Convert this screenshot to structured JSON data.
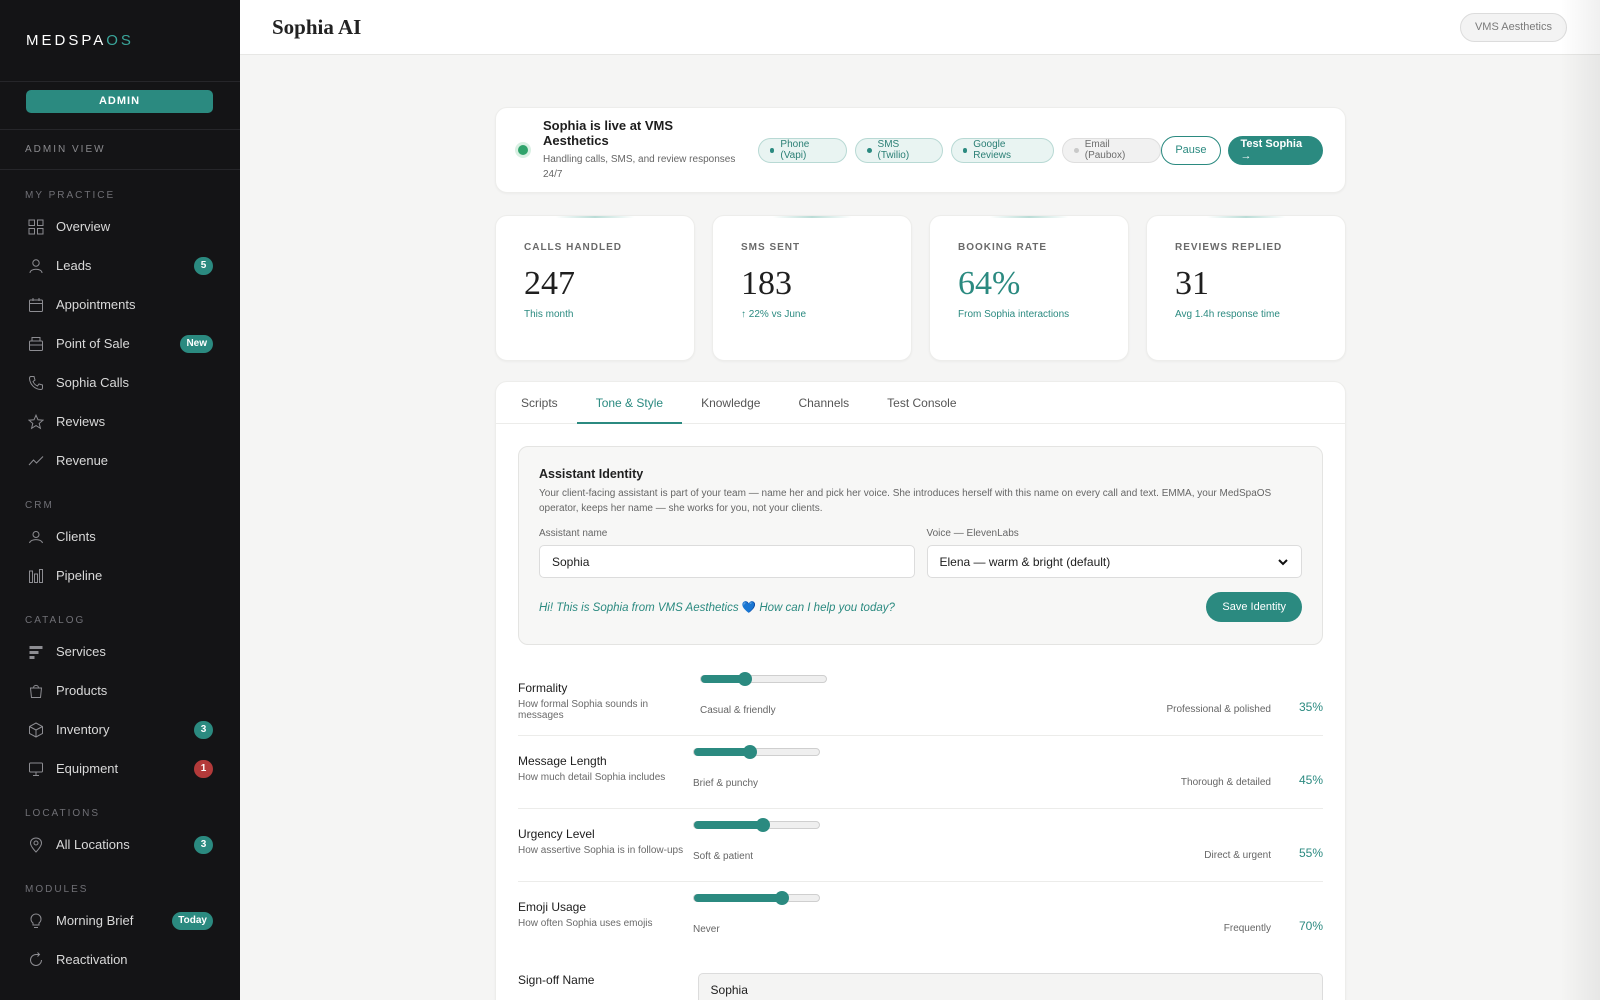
{
  "sidebar": {
    "logo_main": "MEDSPA",
    "logo_accent": "OS",
    "role_button": "ADMIN",
    "view_label": "ADMIN VIEW",
    "sections": [
      {
        "label": "MY PRACTICE",
        "items": [
          {
            "label": "Overview",
            "icon": "grid-icon"
          },
          {
            "label": "Leads",
            "icon": "user-icon",
            "badge": "5"
          },
          {
            "label": "Appointments",
            "icon": "calendar-icon"
          },
          {
            "label": "Point of Sale",
            "icon": "register-icon",
            "badge": "New"
          },
          {
            "label": "Sophia Calls",
            "icon": "phone-icon"
          },
          {
            "label": "Reviews",
            "icon": "star-icon"
          },
          {
            "label": "Revenue",
            "icon": "trend-icon"
          }
        ]
      },
      {
        "label": "CRM",
        "items": [
          {
            "label": "Clients",
            "icon": "clients-icon"
          },
          {
            "label": "Pipeline",
            "icon": "pipeline-icon"
          }
        ]
      },
      {
        "label": "CATALOG",
        "items": [
          {
            "label": "Services",
            "icon": "services-icon"
          },
          {
            "label": "Products",
            "icon": "bag-icon"
          },
          {
            "label": "Inventory",
            "icon": "box-icon",
            "badge": "3"
          },
          {
            "label": "Equipment",
            "icon": "monitor-icon",
            "badge": "1",
            "badge_color": "#b33a3a"
          }
        ]
      },
      {
        "label": "LOCATIONS",
        "items": [
          {
            "label": "All Locations",
            "icon": "pin-icon",
            "badge": "3"
          }
        ]
      },
      {
        "label": "MODULES",
        "items": [
          {
            "label": "Morning Brief",
            "icon": "bulb-icon",
            "badge": "Today"
          },
          {
            "label": "Reactivation",
            "icon": "refresh-icon"
          }
        ]
      }
    ]
  },
  "header": {
    "title": "Sophia AI",
    "practice": "VMS Aesthetics"
  },
  "status": {
    "title": "Sophia is live at VMS Aesthetics",
    "subtitle": "Handling calls, SMS, and review responses 24/7",
    "channels": [
      {
        "label": "Phone (Vapi)",
        "active": true
      },
      {
        "label": "SMS (Twilio)",
        "active": true
      },
      {
        "label": "Google Reviews",
        "active": true
      },
      {
        "label": "Email (Paubox)",
        "active": false
      }
    ],
    "pause_label": "Pause",
    "test_label": "Test Sophia →"
  },
  "stats": [
    {
      "label": "CALLS HANDLED",
      "value": "247",
      "note": "This month"
    },
    {
      "label": "SMS SENT",
      "value": "183",
      "note": "↑ 22% vs June"
    },
    {
      "label": "BOOKING RATE",
      "value": "64%",
      "note": "From Sophia interactions",
      "teal": true
    },
    {
      "label": "REVIEWS REPLIED",
      "value": "31",
      "note": "Avg 1.4h response time"
    }
  ],
  "tabs": [
    {
      "label": "Scripts",
      "active": false
    },
    {
      "label": "Tone & Style",
      "active": true
    },
    {
      "label": "Knowledge",
      "active": false
    },
    {
      "label": "Channels",
      "active": false
    },
    {
      "label": "Test Console",
      "active": false
    }
  ],
  "identity": {
    "title": "Assistant Identity",
    "description": "Your client-facing assistant is part of your team — name her and pick her voice. She introduces herself with this name on every call and text. EMMA, your MedSpaOS operator, keeps her name — she works for you, not your clients.",
    "name_label": "Assistant name",
    "name_value": "Sophia",
    "voice_label": "Voice — ElevenLabs",
    "voice_value": "Elena — warm & bright (default)",
    "greeting": "Hi! This is Sophia from VMS Aesthetics",
    "greeting_end": "How can I help you today?",
    "save_label": "Save Identity"
  },
  "sliders": [
    {
      "name": "Formality",
      "desc": "How formal Sophia sounds in messages",
      "left": "Casual & friendly",
      "right": "Professional & polished",
      "value": 35,
      "pct": "35%"
    },
    {
      "name": "Message Length",
      "desc": "How much detail Sophia includes",
      "left": "Brief & punchy",
      "right": "Thorough & detailed",
      "value": 45,
      "pct": "45%"
    },
    {
      "name": "Urgency Level",
      "desc": "How assertive Sophia is in follow-ups",
      "left": "Soft & patient",
      "right": "Direct & urgent",
      "value": 55,
      "pct": "55%"
    },
    {
      "name": "Emoji Usage",
      "desc": "How often Sophia uses emojis",
      "left": "Never",
      "right": "Frequently",
      "value": 70,
      "pct": "70%"
    }
  ],
  "signoff": {
    "name": "Sign-off Name",
    "value": "Sophia"
  }
}
